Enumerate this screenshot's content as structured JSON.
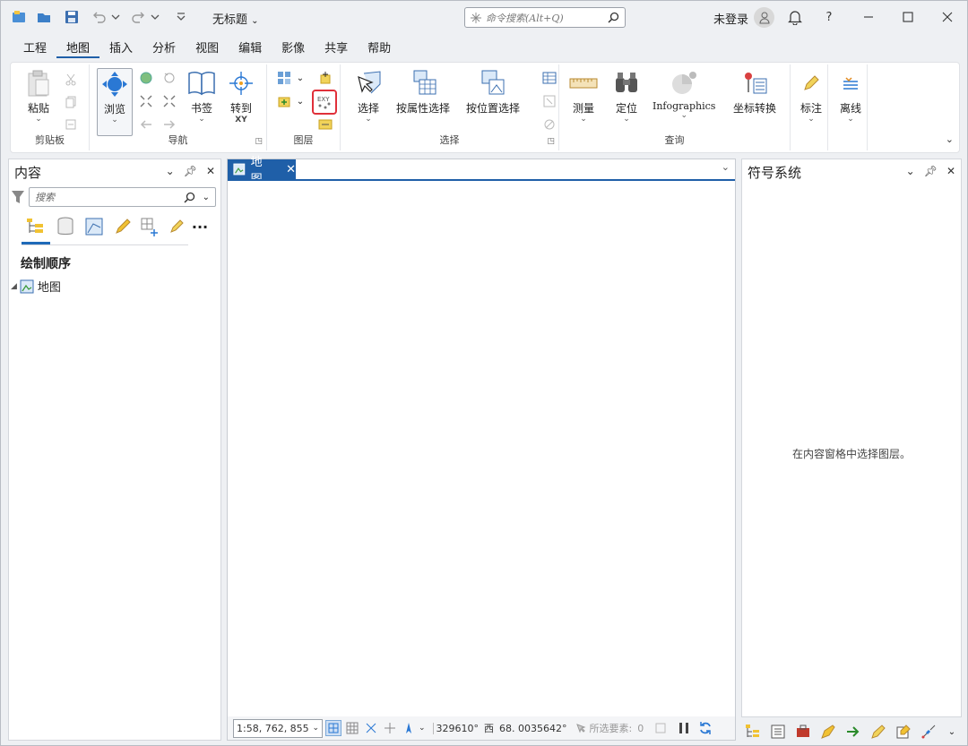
{
  "titlebar": {
    "doc_title": "无标题",
    "search_placeholder": "命令搜索(Alt+Q)",
    "signin": "未登录",
    "help": "?"
  },
  "menu_tabs": [
    "工程",
    "地图",
    "插入",
    "分析",
    "视图",
    "编辑",
    "影像",
    "共享",
    "帮助"
  ],
  "active_tab": "地图",
  "ribbon": {
    "clipboard": {
      "label": "剪贴板",
      "paste": "粘贴"
    },
    "navigate": {
      "label": "导航",
      "explore": "浏览",
      "bookmarks": "书签",
      "goto_xy": "转到",
      "goto_xy_sub": "XY"
    },
    "layer": {
      "label": "图层"
    },
    "selection": {
      "label": "选择",
      "select": "选择",
      "by_attr": "按属性选择",
      "by_loc": "按位置选择"
    },
    "inquiry": {
      "label": "查询",
      "measure": "测量",
      "locate": "定位",
      "infographics": "Infographics",
      "convert": "坐标转换"
    },
    "labeling": {
      "label_btn": "标注",
      "offline": "离线"
    }
  },
  "contents": {
    "title": "内容",
    "search_placeholder": "搜索",
    "drawing_order": "绘制顺序",
    "map_item": "地图"
  },
  "mapview": {
    "tab_label": "地图",
    "scale": "1:58, 762, 855",
    "coord_a": "329610°",
    "coord_dir": "西",
    "coord_b": "68. 0035642°",
    "selected_label": "所选要素:",
    "selected_count": "0"
  },
  "symbology": {
    "title": "符号系统",
    "hint": "在内容窗格中选择图层。"
  },
  "colors": {
    "accent": "#1f5fa8",
    "highlight": "#e0303a"
  }
}
